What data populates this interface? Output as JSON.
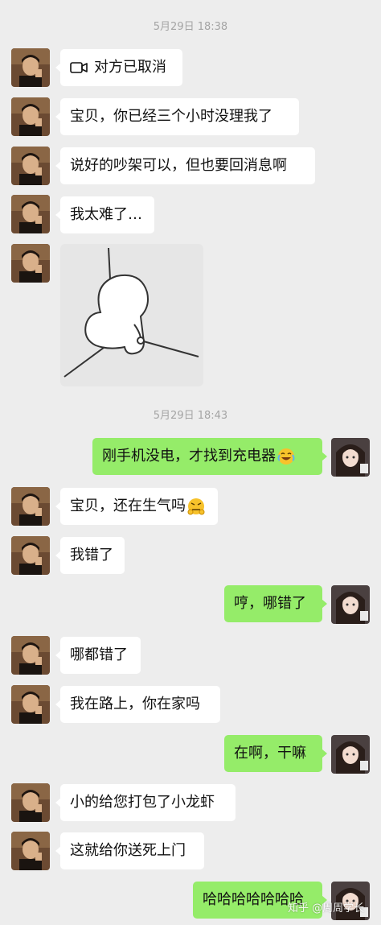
{
  "timestamps": [
    "5月29日 18:38",
    "5月29日 18:43"
  ],
  "messages": {
    "m1": "对方已取消",
    "m2": "宝贝，你已经三个小时没理我了",
    "m3": "说好的吵架可以，但也要回消息啊",
    "m4": "我太难了…",
    "m5": "刚手机没电，才找到充电器",
    "m6": "宝贝，还在生气吗",
    "m7": "我错了",
    "m8": "哼，哪错了",
    "m9": "哪都错了",
    "m10": "我在路上，你在家吗",
    "m11": "在啊，干嘛",
    "m12": "小的给您打包了小龙虾",
    "m13": "这就给你送死上门",
    "m14": "哈哈哈哈哈哈哈"
  },
  "icons": {
    "video_call": "video-camera-icon",
    "emoji_laugh_cry": "laughing-crying-emoji",
    "emoji_awkward": "awkward-emoji",
    "sticker": "sad-blob-sticker"
  },
  "colors": {
    "background": "#ededed",
    "received_bubble": "#ffffff",
    "sent_bubble": "#95ec69"
  },
  "watermark": "知乎 @周周学长"
}
